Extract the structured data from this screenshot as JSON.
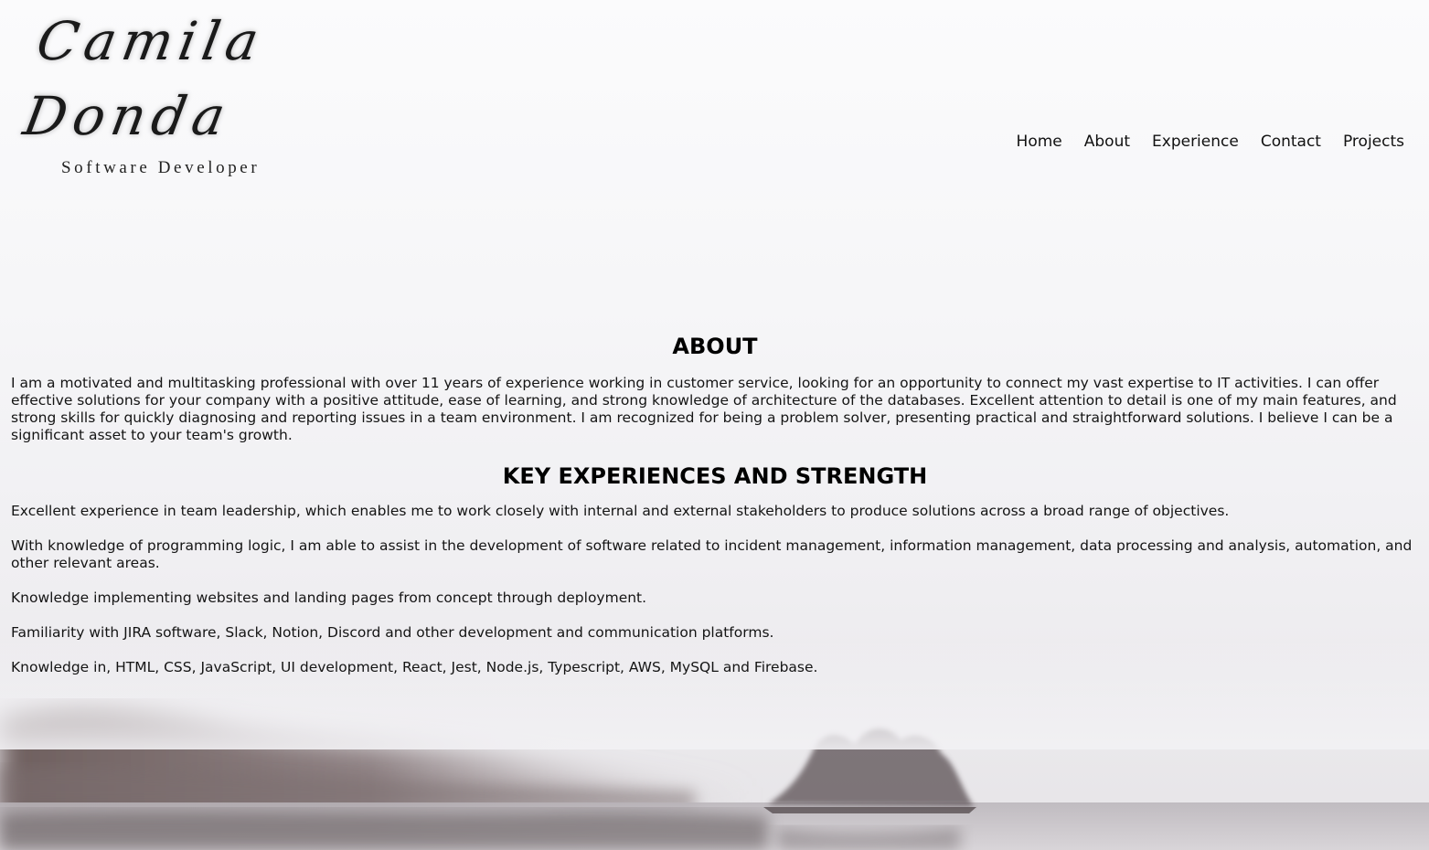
{
  "logo": {
    "signature": "Camila Donda",
    "subtitle": "Software Developer"
  },
  "nav": {
    "items": [
      {
        "label": "Home"
      },
      {
        "label": "About"
      },
      {
        "label": "Experience"
      },
      {
        "label": "Contact"
      },
      {
        "label": "Projects"
      }
    ]
  },
  "about": {
    "title": "ABOUT",
    "text": "I am a motivated and multitasking professional with over 11 years of experience working in customer service, looking for an opportunity to connect my vast expertise to IT activities. I can offer effective solutions for your company with a positive attitude, ease of learning, and strong knowledge of architecture of the databases. Excellent attention to detail is one of my main features, and strong skills for quickly diagnosing and reporting issues in a team environment. I am recognized for being a problem solver, presenting practical and straightforward solutions. I believe I can be a significant asset to your team's growth."
  },
  "experience": {
    "title": "KEY EXPERIENCES AND STRENGTH",
    "items": [
      "Excellent experience in team leadership, which enables me to work closely with internal and external stakeholders to produce solutions across a broad range of objectives.",
      "With knowledge of programming logic, I am able to assist in the development of software related to incident management, information management, data processing and analysis, automation, and other relevant areas.",
      "Knowledge implementing websites and landing pages from concept through deployment.",
      "Familiarity with JIRA software, Slack, Notion, Discord and other development and communication platforms.",
      "Knowledge in, HTML, CSS, JavaScript, UI development, React, Jest, Node.js, Typescript, AWS, MySQL and Firebase."
    ]
  }
}
